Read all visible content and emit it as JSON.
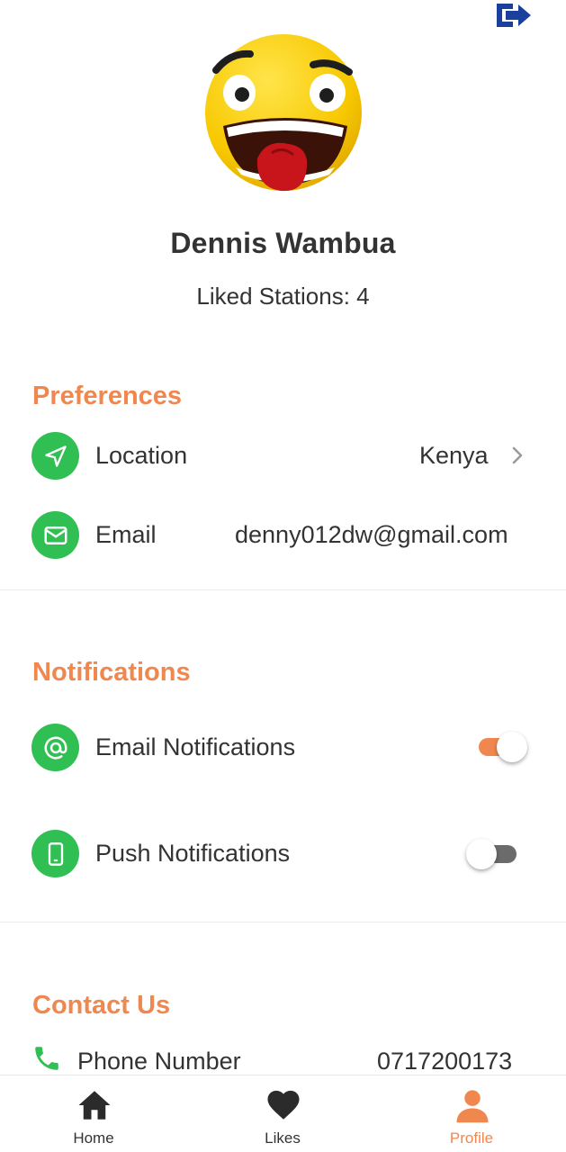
{
  "header": {
    "logout_icon": "logout-icon"
  },
  "profile": {
    "avatar_icon": "emoji-avatar",
    "name": "Dennis Wambua",
    "liked_stations": "Liked Stations: 4"
  },
  "preferences": {
    "title": "Preferences",
    "location": {
      "label": "Location",
      "value": "Kenya",
      "icon": "navigation-icon"
    },
    "email": {
      "label": "Email",
      "value": "denny012dw@gmail.com",
      "icon": "mail-icon"
    }
  },
  "notifications": {
    "title": "Notifications",
    "email": {
      "label": "Email Notifications",
      "enabled": true,
      "icon": "at-icon"
    },
    "push": {
      "label": "Push Notifications",
      "enabled": false,
      "icon": "phone-icon"
    }
  },
  "contact": {
    "title": "Contact Us",
    "phone": {
      "label": "Phone Number",
      "value": "0717200173",
      "icon": "phone-call-icon"
    }
  },
  "nav": {
    "home": "Home",
    "likes": "Likes",
    "profile": "Profile",
    "active": "profile"
  },
  "colors": {
    "accent": "#f0874f",
    "icon_green": "#2fbf52",
    "logout_blue": "#1a3f9c",
    "toggle_on_track": "#f0874f",
    "toggle_off_track": "#6b6b6b"
  }
}
